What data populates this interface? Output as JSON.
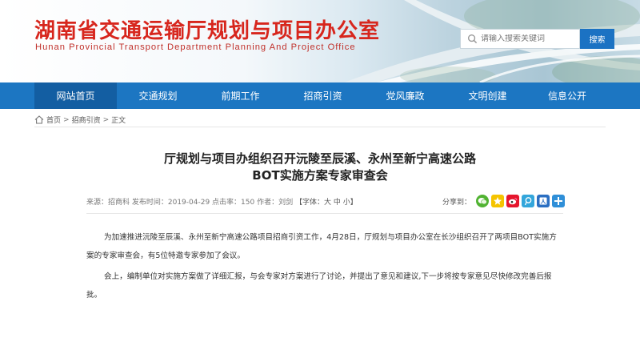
{
  "header": {
    "title": "湖南省交通运输厅规划与项目办公室",
    "subtitle": "Hunan Provincial Transport Department Planning And Project Office",
    "search_placeholder": "请输入搜索关键词",
    "search_button": "搜索"
  },
  "nav": {
    "items": [
      {
        "label": "网站首页",
        "active": true
      },
      {
        "label": "交通规划",
        "active": false
      },
      {
        "label": "前期工作",
        "active": false
      },
      {
        "label": "招商引资",
        "active": false
      },
      {
        "label": "党风廉政",
        "active": false
      },
      {
        "label": "文明创建",
        "active": false
      },
      {
        "label": "信息公开",
        "active": false
      }
    ]
  },
  "breadcrumb": {
    "home": "首页",
    "section": "招商引资",
    "current": "正文",
    "separator": ">"
  },
  "article": {
    "title_line1": "厅规划与项目办组织召开沅陵至辰溪、永州至新宁高速公路",
    "title_line2": "BOT实施方案专家审查会",
    "meta_text": "来源：招商科 发布时间：2019-04-29 点击率：150 作者：刘剑",
    "font_size_label": "【字体：",
    "font_large": "大",
    "font_medium": "中",
    "font_small": "小",
    "font_size_close": "】",
    "share_label": "分享到：",
    "paragraphs": [
      "为加速推进沅陵至辰溪、永州至新宁高速公路项目招商引资工作，4月28日，厅规划与项目办公室在长沙组织召开了两项目BOT实施方案的专家审查会，有5位特邀专家参加了会议。",
      "会上，编制单位对实施方案做了详细汇报，与会专家对方案进行了讨论，并提出了意见和建议,下一步将按专家意见尽快修改完善后报批。"
    ]
  },
  "share_icons": [
    "wechat-icon",
    "qzone-icon",
    "weibo-icon",
    "tencent-weibo-icon",
    "renren-icon",
    "more-icon"
  ],
  "colors": {
    "title_red": "#d7261d",
    "nav_blue": "#1c76c2",
    "nav_active": "#135ea2",
    "search_button": "#1b72c3"
  }
}
